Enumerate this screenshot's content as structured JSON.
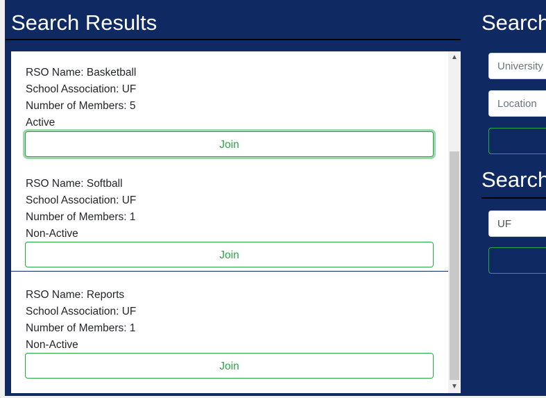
{
  "results": {
    "title": "Search Results",
    "cards": [
      {
        "name_line": "RSO Name: Basketball",
        "school_line": "School Association: UF",
        "members_line": "Number of Members: 5",
        "status": "Active",
        "join_label": "Join"
      },
      {
        "name_line": "RSO Name: Softball",
        "school_line": "School Association: UF",
        "members_line": "Number of Members: 1",
        "status": "Non-Active",
        "join_label": "Join"
      },
      {
        "name_line": "RSO Name: Reports",
        "school_line": "School Association: UF",
        "members_line": "Number of Members: 1",
        "status": "Non-Active",
        "join_label": "Join"
      }
    ]
  },
  "sidebar": {
    "search1": {
      "title": "Search",
      "university_placeholder": "University",
      "location_placeholder": "Location"
    },
    "search2": {
      "title": "Search",
      "school_value": "UF"
    }
  },
  "colors": {
    "background": "#0f2a63",
    "accent": "#28a745"
  },
  "icons": {
    "scroll_up": "chevron-up-icon",
    "scroll_down": "chevron-down-icon"
  }
}
